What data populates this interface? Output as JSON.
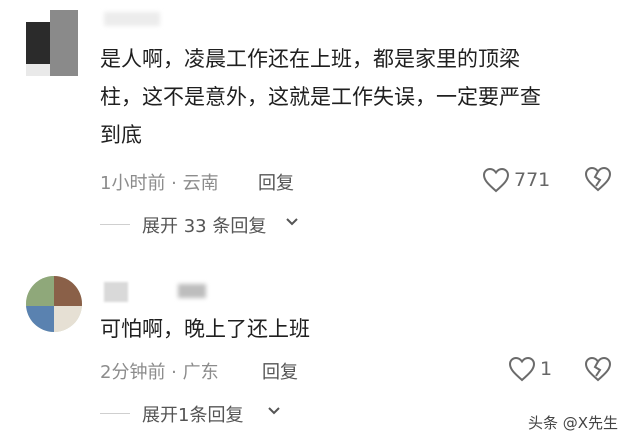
{
  "comments": [
    {
      "text_line1": "是人啊，凌晨工作还在上班，都是家里的顶梁",
      "text_line2": "柱，这不是意外，这就是工作失误，一定要严查",
      "text_line3": "到底",
      "time_location": "1小时前 · 云南",
      "reply_label": "回复",
      "like_count": "771",
      "expand_label": "展开 33 条回复"
    },
    {
      "text_line1": "可怕啊，晚上了还上班",
      "time_location": "2分钟前 · 广东",
      "reply_label": "回复",
      "like_count": "1",
      "expand_label": "展开1条回复"
    }
  ],
  "watermark": "头条 @X先生",
  "colors": {
    "text": "#1f1f1f",
    "meta": "#8c8c8c",
    "icon": "#6b6b6b"
  }
}
